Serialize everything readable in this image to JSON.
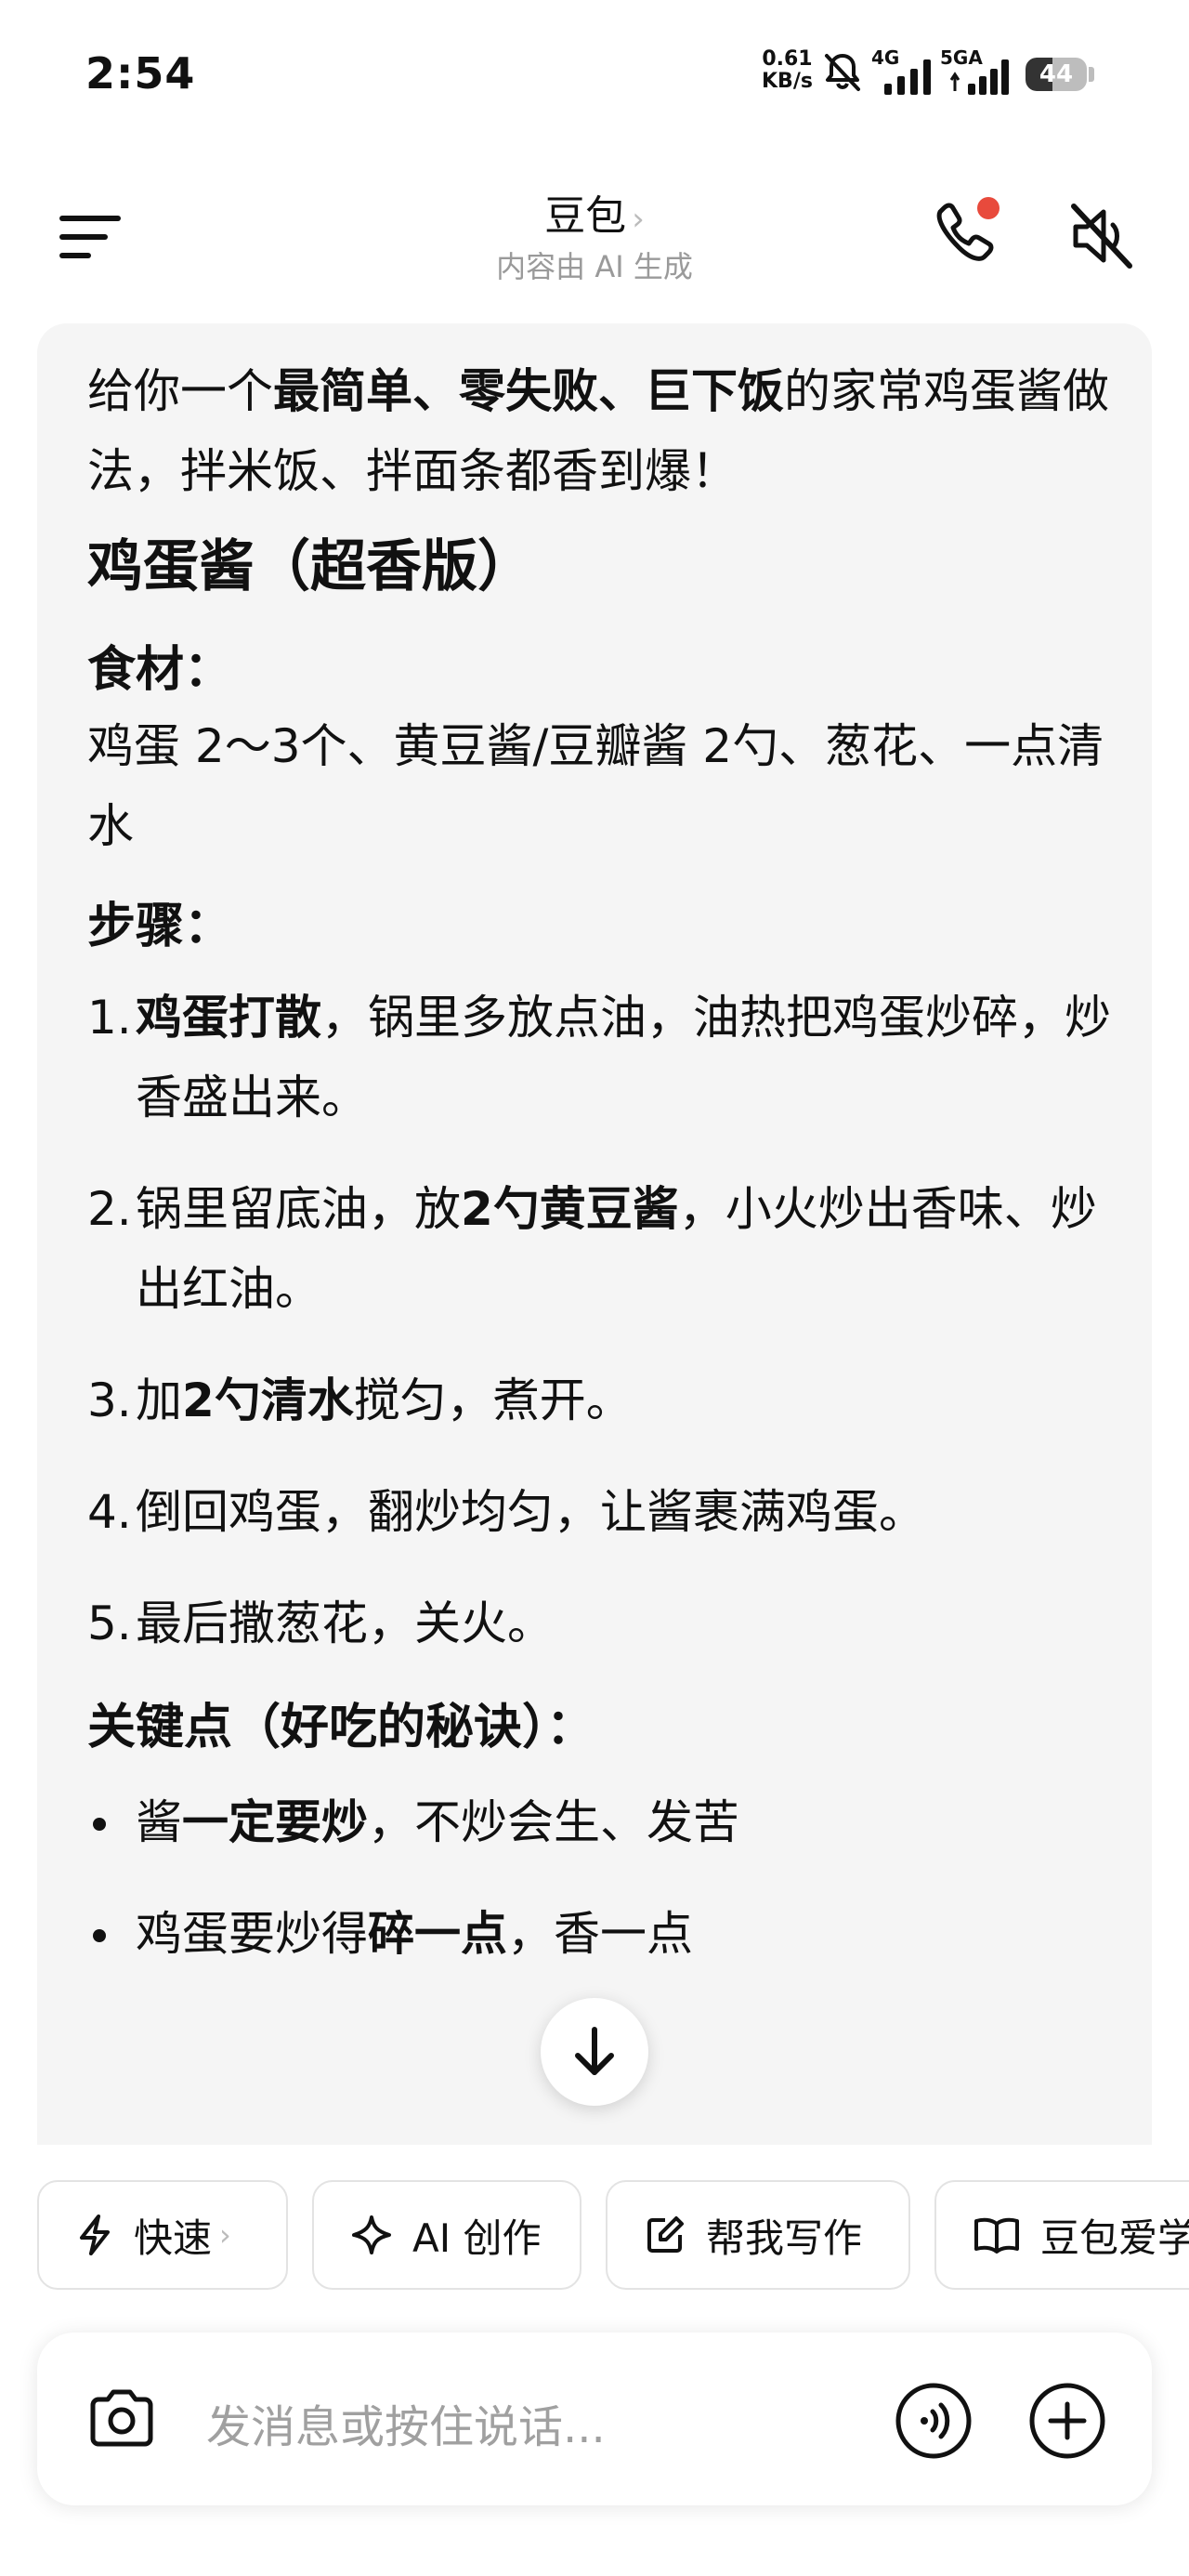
{
  "status_bar": {
    "time": "2:54",
    "net_speed_value": "0.61",
    "net_speed_unit": "KB/s",
    "signal_1": "4G",
    "signal_2": "5GA",
    "battery": "44",
    "battery_level": 0.44
  },
  "header": {
    "title": "豆包",
    "subtitle": "内容由 AI 生成",
    "menu_icon": "hamburger-icon",
    "call_icon": "phone-icon",
    "mute_icon": "speaker-muted-icon",
    "accent": "#e84a3c"
  },
  "message": {
    "intro_pre": "给你一个",
    "intro_bold": "最简单、零失败、巨下饭",
    "intro_post": "的家常鸡蛋酱做法，拌米饭、拌面条都香到爆！",
    "title": "鸡蛋酱（超香版）",
    "ingredients_heading": "食材：",
    "ingredients": "鸡蛋 2～3个、黄豆酱/豆瓣酱 2勺、葱花、一点清水",
    "steps_heading": "步骤：",
    "steps": [
      {
        "num": "1.",
        "pre": "",
        "bold": "鸡蛋打散",
        "post": "，锅里多放点油，油热把鸡蛋炒碎，炒香盛出来。"
      },
      {
        "num": "2.",
        "pre": "锅里留底油，放",
        "bold": "2勺黄豆酱",
        "post": "，小火炒出香味、炒出红油。"
      },
      {
        "num": "3.",
        "pre": "加",
        "bold": "2勺清水",
        "post": "搅匀，煮开。"
      },
      {
        "num": "4.",
        "pre": "倒回鸡蛋，翻炒均匀，让酱裹满鸡蛋。",
        "bold": "",
        "post": ""
      },
      {
        "num": "5.",
        "pre": "最后撒葱花，关火。",
        "bold": "",
        "post": ""
      }
    ],
    "tips_heading": "关键点（好吃的秘诀）：",
    "tips": [
      {
        "pre": "酱",
        "bold": "一定要炒",
        "post": "，不炒会生、发苦"
      },
      {
        "pre": "鸡蛋要炒得",
        "bold": "碎一点",
        "post": "，香一点"
      }
    ]
  },
  "scroll_down_icon": "arrow-down-icon",
  "chips": [
    {
      "label": "快速",
      "icon": "lightning-icon"
    },
    {
      "label": "AI 创作",
      "icon": "sparkle-icon"
    },
    {
      "label": "帮我写作",
      "icon": "edit-icon"
    },
    {
      "label": "豆包爱学",
      "icon": "book-icon"
    }
  ],
  "input": {
    "placeholder": "发消息或按住说话...",
    "camera_icon": "camera-icon",
    "voice_icon": "voice-wave-icon",
    "plus_icon": "plus-icon"
  }
}
